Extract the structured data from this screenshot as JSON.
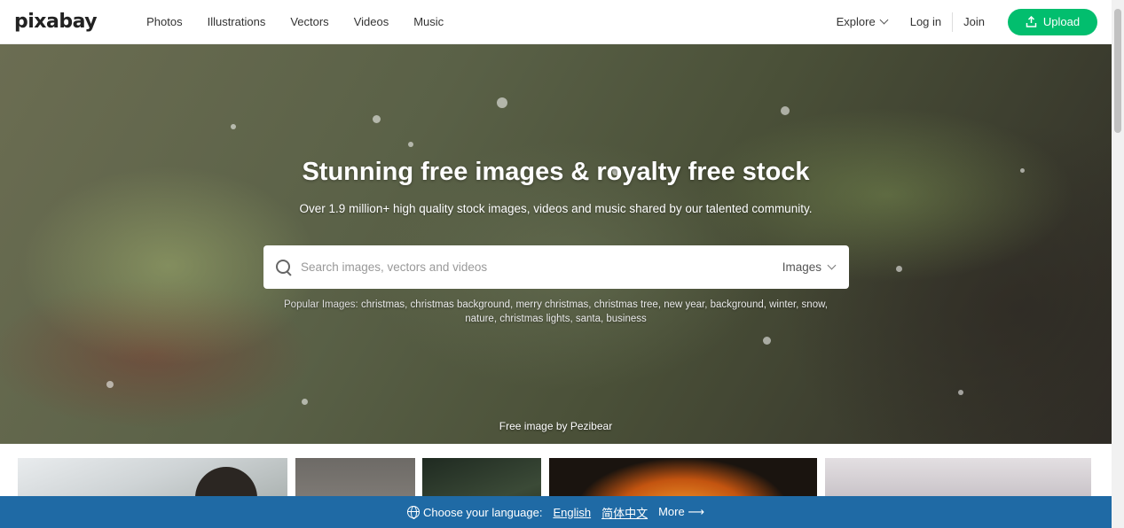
{
  "header": {
    "logo": "pixabay",
    "nav": [
      "Photos",
      "Illustrations",
      "Vectors",
      "Videos",
      "Music"
    ],
    "explore": "Explore",
    "login": "Log in",
    "join": "Join",
    "upload": "Upload",
    "upload_color": "#02be6e"
  },
  "hero": {
    "title": "Stunning free images & royalty free stock",
    "subtitle": "Over 1.9 million+ high quality stock images, videos and music shared by our talented community.",
    "search_placeholder": "Search images, vectors and videos",
    "search_type": "Images",
    "popular_label": "Popular Images:",
    "popular_terms": "christmas, christmas background, merry christmas, christmas tree, new year, background, winter, snow, nature, christmas lights, santa, business",
    "credit": "Free image by Pezibear"
  },
  "language_bar": {
    "label": "Choose your language:",
    "english": "English",
    "chinese": "简体中文",
    "more": "More",
    "bar_color": "#1f6aa5"
  }
}
